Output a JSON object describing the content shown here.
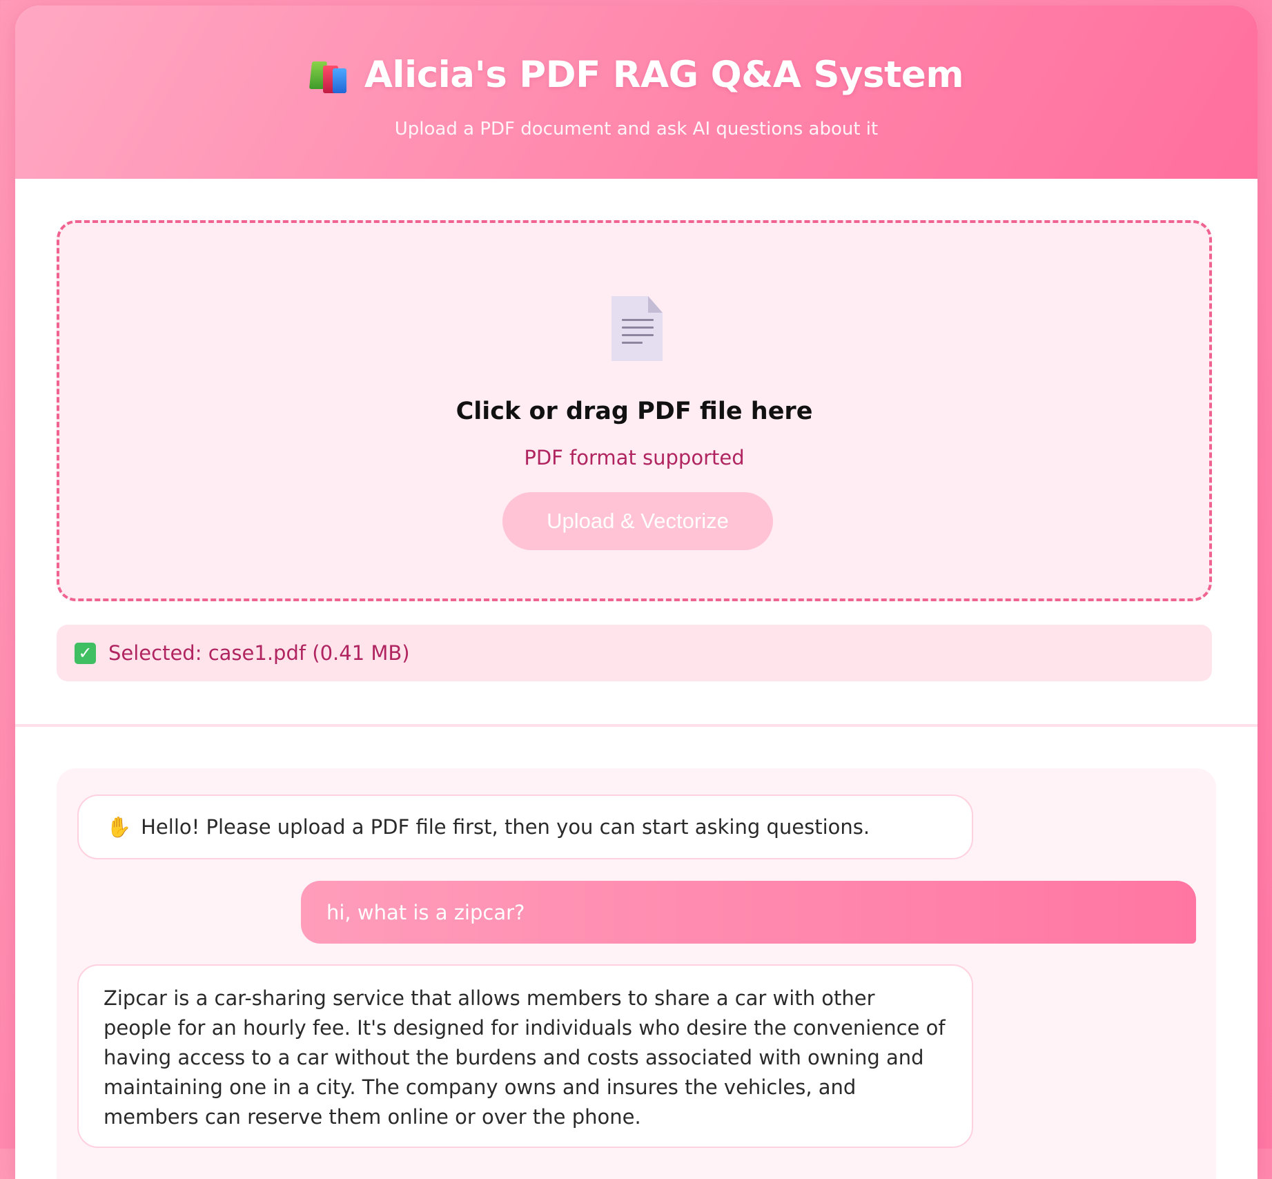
{
  "header": {
    "title": "Alicia's PDF RAG Q&A System",
    "subtitle": "Upload a PDF document and ask AI questions about it",
    "icon": "books-icon"
  },
  "upload": {
    "icon": "document-icon",
    "title": "Click or drag PDF file here",
    "subtitle": "PDF format supported",
    "button_label": "Upload & Vectorize"
  },
  "selected_file": {
    "icon": "check-icon",
    "text": "Selected: case1.pdf (0.41 MB)"
  },
  "chat": {
    "messages": [
      {
        "role": "bot",
        "icon": "waving-hand-icon",
        "text": "Hello! Please upload a PDF file first, then you can start asking questions."
      },
      {
        "role": "user",
        "text": "hi, what is a zipcar?"
      },
      {
        "role": "bot",
        "text": "Zipcar is a car-sharing service that allows members to share a car with other people for an hourly fee. It's designed for individuals who desire the convenience of having access to a car without the burdens and costs associated with owning and maintaining one in a city. The company owns and insures the vehicles, and members can reserve them online or over the phone."
      }
    ]
  },
  "colors": {
    "accent": "#ff7aa6",
    "accent_dark": "#b0245f",
    "dashed_border": "#f0628f",
    "upload_zone_bg": "#ffedf3",
    "button_disabled": "#ffc3d5"
  }
}
